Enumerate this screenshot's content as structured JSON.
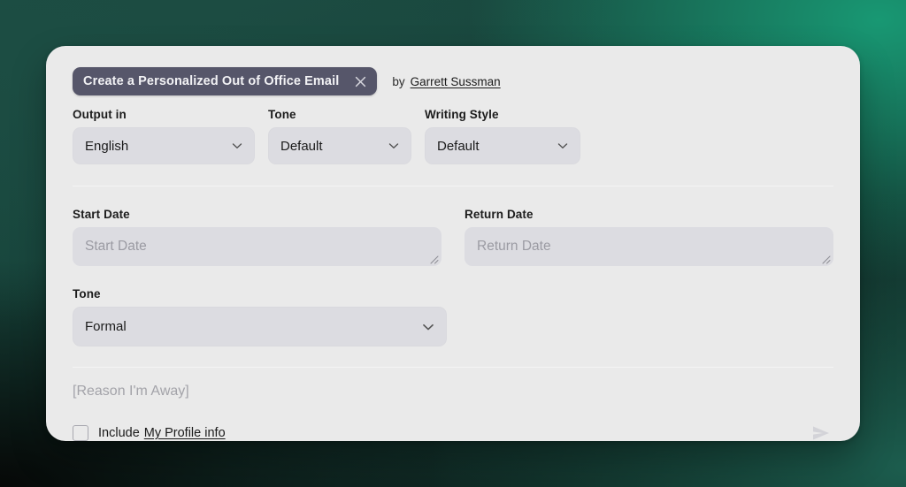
{
  "header": {
    "prompt_chip": {
      "label": "Create a Personalized Out of Office Email",
      "close_icon": "close-icon"
    },
    "byline_prefix": "by",
    "byline_author": "Garrett Sussman"
  },
  "top_options": [
    {
      "label": "Output in",
      "value": "English",
      "icon": "chevron-down-icon"
    },
    {
      "label": "Tone",
      "value": "Default",
      "icon": "chevron-down-icon"
    },
    {
      "label": "Writing Style",
      "value": "Default",
      "icon": "chevron-down-icon"
    }
  ],
  "dates": [
    {
      "label": "Start Date",
      "placeholder": "Start Date",
      "value": ""
    },
    {
      "label": "Return Date",
      "placeholder": "Return Date",
      "value": ""
    }
  ],
  "tone": {
    "label": "Tone",
    "value": "Formal",
    "icon": "chevron-down-icon"
  },
  "reason": {
    "placeholder": "[Reason I'm Away]"
  },
  "footer": {
    "checkbox_checked": false,
    "include_text": "Include",
    "include_link": "My Profile info",
    "send_icon": "send-icon"
  },
  "colors": {
    "card_background": "#eaeaea",
    "input_fill": "#dcdce1",
    "chip_background": "#56566a",
    "chip_text": "#f2f2f5",
    "placeholder_text": "#9b9ba3",
    "divider": "#dddddd",
    "backdrop_green_light": "#189873",
    "backdrop_green_dark": "#1d4c42",
    "backdrop_black": "#0a1512",
    "send_icon": "#d3d3d8"
  }
}
